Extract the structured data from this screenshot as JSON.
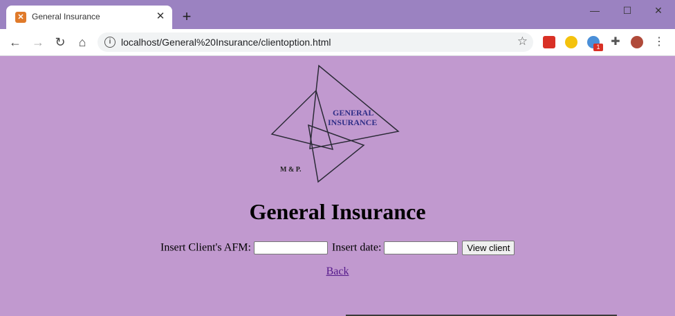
{
  "browser": {
    "tab_title": "General Insurance",
    "tab_close": "✕",
    "new_tab": "+",
    "url": "localhost/General%20Insurance/clientoption.html",
    "window_controls": {
      "minimize": "—",
      "maximize": "☐",
      "close": "✕"
    },
    "extension_badge": "1"
  },
  "logo": {
    "line1": "GENERAL",
    "line2": "INSURANCE",
    "mark": "M & P."
  },
  "page": {
    "title": "General Insurance",
    "afm_label": "Insert Client's AFM:",
    "afm_value": "",
    "date_label": "Insert date:",
    "date_value": "",
    "view_button": "View client",
    "back_link": "Back"
  },
  "colors": {
    "page_background": "#c199cf",
    "titlebar": "#9b82c1",
    "link": "#551a8b"
  }
}
